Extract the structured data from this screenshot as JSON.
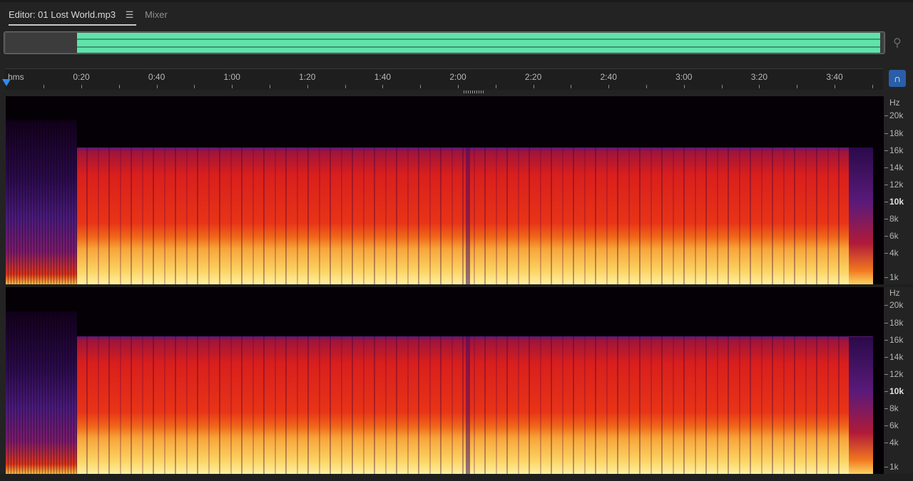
{
  "tabs": {
    "editor_label": "Editor: 01 Lost World.mp3",
    "mixer_label": "Mixer"
  },
  "icons": {
    "panel_menu": "menu-lines-icon",
    "zoom": "zoom-magnifier-icon",
    "snap": "snap-magnet-icon"
  },
  "ruler": {
    "unit": "hms",
    "labels": [
      "0:20",
      "0:40",
      "1:00",
      "1:20",
      "1:40",
      "2:00",
      "2:20",
      "2:40",
      "3:00",
      "3:20",
      "3:40"
    ]
  },
  "frequency_axis": {
    "unit": "Hz",
    "labels": [
      "20k",
      "18k",
      "16k",
      "14k",
      "12k",
      "10k",
      "8k",
      "6k",
      "4k",
      "1k"
    ],
    "bold_label": "10k"
  },
  "colors": {
    "overview_wave": "#5fe3aa",
    "playhead": "#2f8cf0",
    "snap_button": "#2a5ea8"
  }
}
